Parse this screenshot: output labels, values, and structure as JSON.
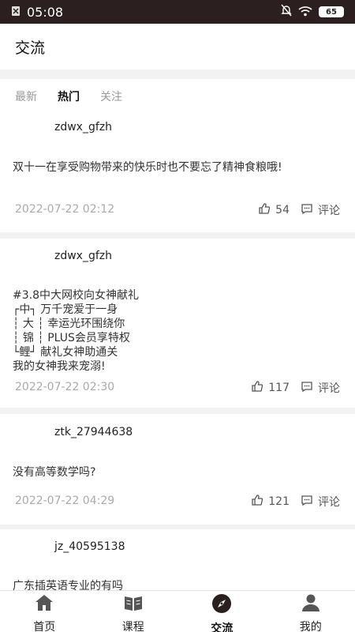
{
  "status_bar": {
    "time": "05:08",
    "battery": "65"
  },
  "header": {
    "title": "交流"
  },
  "tabs": [
    {
      "label": "最新",
      "active": false
    },
    {
      "label": "热门",
      "active": true
    },
    {
      "label": "关注",
      "active": false
    }
  ],
  "posts": [
    {
      "username": "zdwx_gfzh",
      "content": "双十一在享受购物带来的快乐时也不要忘了精神食粮哦!",
      "date": "2022-07-22 02:12",
      "likes": "54",
      "comment_label": "评论"
    },
    {
      "username": "zdwx_gfzh",
      "content": "#3.8中大网校向女神献礼\n┌中┐ 万千宠爱于一身\n┆ 大 ┆ 幸运光环围绕你\n┆ 锦 ┆ PLUS会员享特权\n└鲤┘ 献礼女神助通关\n我的女神我来宠溺!",
      "date": "2022-07-22 02:30",
      "likes": "117",
      "comment_label": "评论"
    },
    {
      "username": "ztk_27944638",
      "content": "没有高等数学吗?",
      "date": "2022-07-22 04:29",
      "likes": "121",
      "comment_label": "评论"
    },
    {
      "username": "jz_40595138",
      "content": "广东插英语专业的有吗"
    }
  ],
  "bottom_nav": [
    {
      "label": "首页",
      "icon": "home-icon"
    },
    {
      "label": "课程",
      "icon": "book-icon"
    },
    {
      "label": "交流",
      "icon": "compass-icon",
      "active": true
    },
    {
      "label": "我的",
      "icon": "user-icon"
    }
  ]
}
